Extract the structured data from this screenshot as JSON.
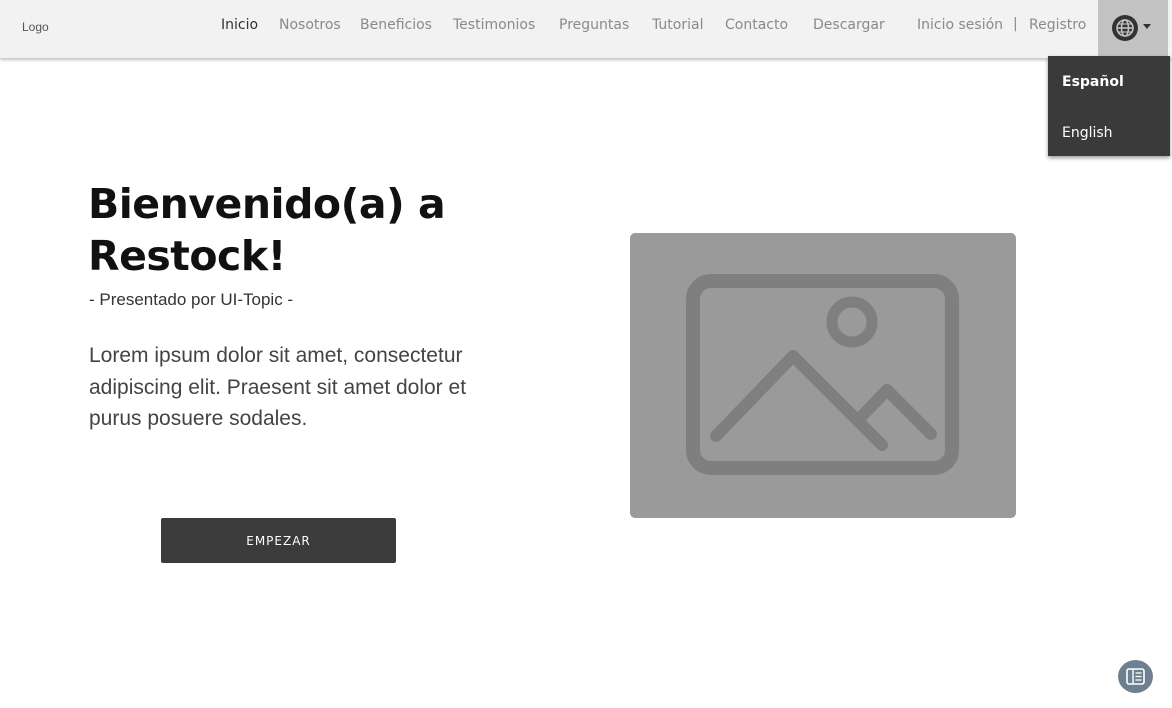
{
  "header": {
    "logo": "Logo",
    "nav": [
      {
        "label": "Inicio",
        "active": true
      },
      {
        "label": "Nosotros",
        "active": false
      },
      {
        "label": "Beneficios",
        "active": false
      },
      {
        "label": "Testimonios",
        "active": false
      },
      {
        "label": "Preguntas",
        "active": false
      },
      {
        "label": "Tutorial",
        "active": false
      },
      {
        "label": "Contacto",
        "active": false
      },
      {
        "label": "Descargar",
        "active": false
      }
    ],
    "login": "Inicio sesión",
    "separator": "|",
    "register": "Registro",
    "language_icon": "globe-icon"
  },
  "language_menu": {
    "items": [
      {
        "label": "Español",
        "selected": true
      },
      {
        "label": "English",
        "selected": false
      }
    ]
  },
  "hero": {
    "title": "Bienvenido(a) a Restock!",
    "subtitle": "- Presentado por UI-Topic -",
    "text": "Lorem ipsum dolor sit amet, consectetur adipiscing elit. Praesent sit amet dolor et purus posuere sodales.",
    "cta": "EMPEZAR",
    "image_icon": "image-placeholder-icon"
  },
  "floating": {
    "icon": "reader-icon"
  },
  "colors": {
    "nav_bg": "#f2f2f2",
    "nav_active": "#333333",
    "nav_inactive": "#8a8a8a",
    "menu_bg": "#3a3a3a",
    "button_bg": "#3b3b3b",
    "placeholder_bg": "#9a9a9a",
    "placeholder_fg": "#7f7f7f",
    "floating_bg": "#6e8090"
  }
}
